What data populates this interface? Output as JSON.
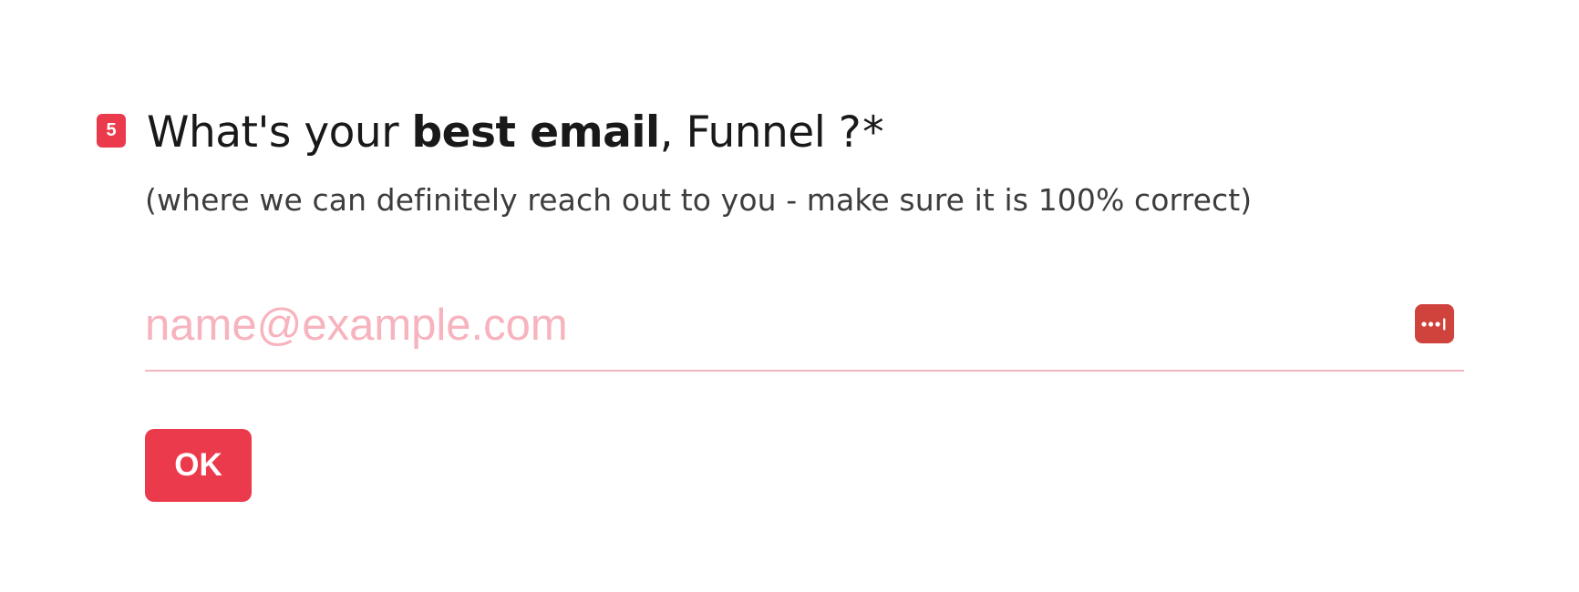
{
  "question": {
    "number": "5",
    "title_prefix": "What's your ",
    "title_bold": "best email",
    "title_suffix": ", Funnel ?",
    "required_mark": "*",
    "subtitle": "(where we can definitely reach out to you - make sure it is 100% correct)"
  },
  "email_field": {
    "value": "",
    "placeholder": "name@example.com",
    "autofill_icon": "password-key-icon"
  },
  "ok_button": {
    "label": "OK"
  },
  "colors": {
    "accent": "#ec3a4d",
    "placeholder": "#f7b3be",
    "underline": "#f5b6c0",
    "autofill_icon_bg": "#d0433c",
    "title_text": "#191919",
    "subtitle_text": "#3d3d3d"
  }
}
